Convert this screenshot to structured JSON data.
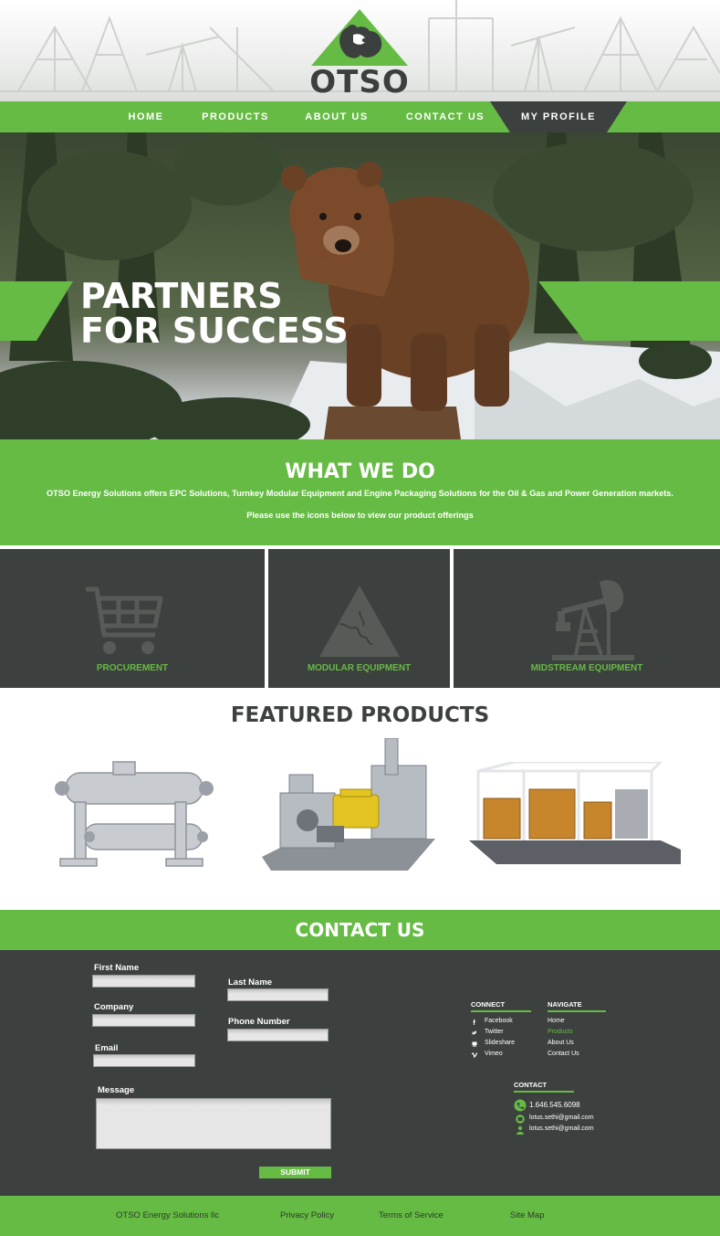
{
  "brand": {
    "name": "OTSO",
    "accent": "#66bb44",
    "dark": "#3c403e"
  },
  "nav": {
    "items": [
      {
        "label": "HOME"
      },
      {
        "label": "PRODUCTS"
      },
      {
        "label": "ABOUT US"
      },
      {
        "label": "CONTACT US"
      },
      {
        "label": "MY PROFILE"
      }
    ]
  },
  "hero": {
    "line1": "PARTNERS",
    "line2": "FOR SUCCESS"
  },
  "what_we_do": {
    "title": "WHAT WE DO",
    "description": "OTSO Energy Solutions offers EPC Solutions, Turnkey Modular Equipment and Engine Packaging Solutions for the Oil & Gas and Power Generation markets.",
    "note": "Please use the icons below to view our product offerings"
  },
  "services": [
    {
      "label": "PROCUREMENT",
      "icon": "shopping-cart-icon"
    },
    {
      "label": "MODULAR EQUIPMENT",
      "icon": "puzzle-triangle-icon"
    },
    {
      "label": "MIDSTREAM EQUIPMENT",
      "icon": "oil-pump-icon"
    }
  ],
  "featured": {
    "title": "FEATURED PRODUCTS"
  },
  "contact": {
    "title": "CONTACT US",
    "form": {
      "first_name": "First Name",
      "last_name": "Last Name",
      "company": "Company",
      "phone": "Phone Number",
      "email": "Email",
      "message": "Message",
      "submit": "SUBMIT"
    },
    "connect": {
      "heading": "CONNECT",
      "links": [
        "Facebook",
        "Twitter",
        "Slideshare",
        "Vimeo"
      ]
    },
    "navigate": {
      "heading": "NAVIGATE",
      "links": [
        "Home",
        "Products",
        "About Us",
        "Contact Us"
      ]
    },
    "details": {
      "heading": "CONTACT",
      "phone": "1.646.545.6098",
      "email1": "lotus.sethi@gmail.com",
      "email2": "lotus.sethi@gmail.com"
    }
  },
  "footer": {
    "company": "OTSO Energy Solutions llc",
    "privacy": "Privacy Policy",
    "terms": "Terms of Service",
    "sitemap": "Site Map"
  }
}
